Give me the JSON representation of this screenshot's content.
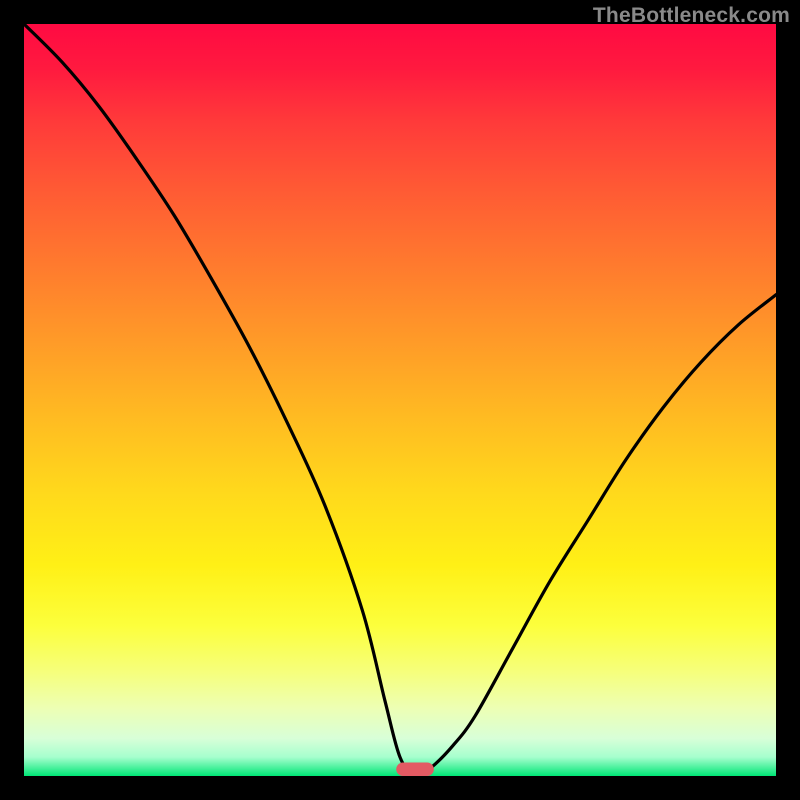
{
  "watermark": "TheBottleneck.com",
  "chart_data": {
    "type": "line",
    "title": "",
    "xlabel": "",
    "ylabel": "",
    "xlim": [
      0,
      100
    ],
    "ylim": [
      0,
      100
    ],
    "x": [
      0,
      5,
      10,
      15,
      20,
      25,
      30,
      35,
      40,
      45,
      48,
      50,
      52,
      54,
      57,
      60,
      65,
      70,
      75,
      80,
      85,
      90,
      95,
      100
    ],
    "values": [
      100,
      95,
      89,
      82,
      74.5,
      66,
      57,
      47,
      36,
      22,
      10,
      2.5,
      0,
      1,
      4,
      8,
      17,
      26,
      34,
      42,
      49,
      55,
      60,
      64
    ],
    "marker": {
      "x": 52,
      "y": 0,
      "width": 5,
      "height": 1.8,
      "color": "#e35a63"
    },
    "background_gradient": {
      "stops": [
        {
          "pos": 0.0,
          "color": "#ff0a42"
        },
        {
          "pos": 0.5,
          "color": "#ffba22"
        },
        {
          "pos": 0.8,
          "color": "#fcff3c"
        },
        {
          "pos": 1.0,
          "color": "#00e676"
        }
      ]
    }
  }
}
